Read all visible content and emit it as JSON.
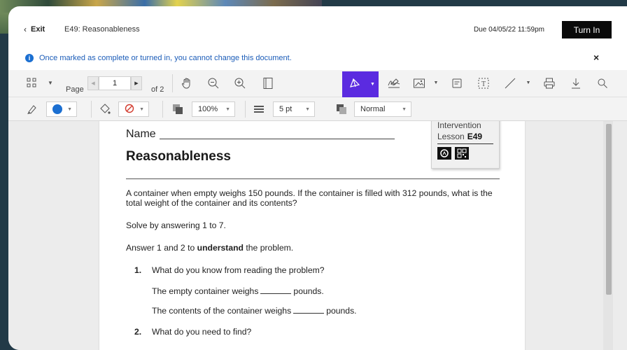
{
  "header": {
    "exit_label": "Exit",
    "doc_title": "E49: Reasonableness",
    "due": "Due 04/05/22 11:59pm",
    "turn_in": "Turn In"
  },
  "notice": {
    "text": "Once marked as complete or turned in, you cannot change this document.",
    "icon": "info-icon",
    "close": "×"
  },
  "toolbar": {
    "page_label": "Page",
    "page_value": "1",
    "of_pages": "of 2",
    "zoom": "100%",
    "stroke_width": "5 pt",
    "blend_mode": "Normal",
    "accent_color": "#5b2be0",
    "fill_color": "#1b6fd1"
  },
  "document": {
    "name_label": "Name",
    "title": "Reasonableness",
    "lesson_line1": "Intervention",
    "lesson_line2": "Lesson",
    "lesson_code": "E49",
    "problem": "A container when empty weighs 150 pounds. If the container is filled with 312 pounds, what is the total weight of the container and its contents?",
    "solve": "Solve by answering 1 to 7.",
    "answer_pre": "Answer 1 and 2 to",
    "answer_bold": "understand",
    "answer_post": "the problem.",
    "q1_num": "1.",
    "q1": "What do you know from reading the problem?",
    "q1a_pre": "The empty container weighs",
    "q1a_post": "pounds.",
    "q1b_pre": "The contents of the container weighs",
    "q1b_post": "pounds.",
    "q2_num": "2.",
    "q2": "What do you need to find?"
  }
}
